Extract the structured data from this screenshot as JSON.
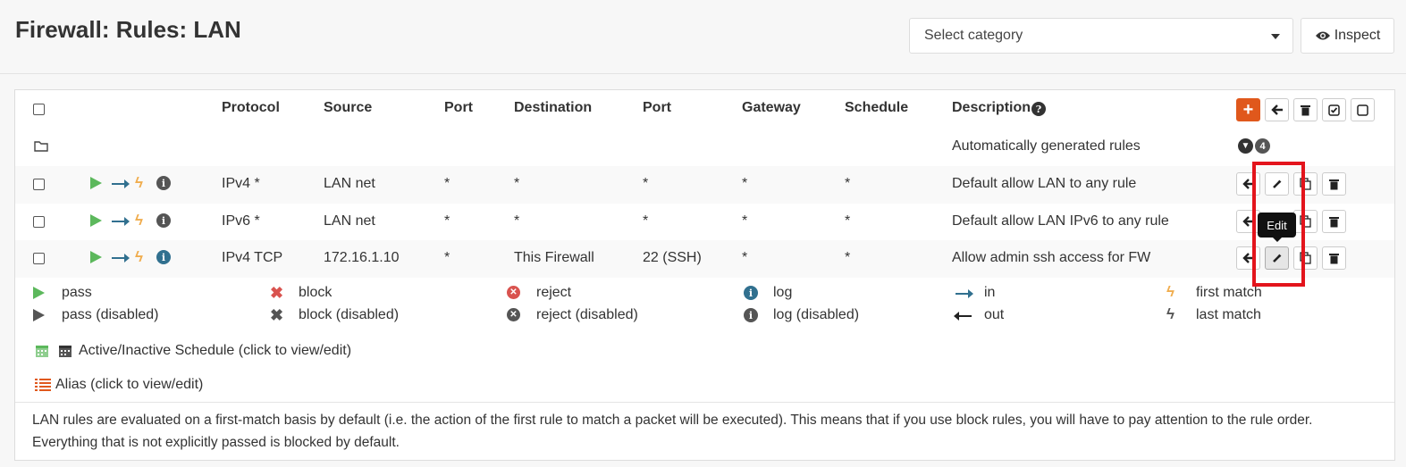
{
  "page": {
    "title": "Firewall: Rules: LAN"
  },
  "category_select": {
    "value": "Select category"
  },
  "inspect_button": {
    "label": "Inspect"
  },
  "table": {
    "headers": [
      "Protocol",
      "Source",
      "Port",
      "Destination",
      "Port",
      "Gateway",
      "Schedule",
      "Description"
    ],
    "auto_group": {
      "label": "Automatically generated rules",
      "count": "4"
    },
    "rules": [
      {
        "protocol": "IPv4 *",
        "source": "LAN net",
        "src_port": "*",
        "destination": "*",
        "dst_port": "*",
        "gateway": "*",
        "schedule": "*",
        "description": "Default allow LAN to any rule",
        "log_icon_color": "#555555"
      },
      {
        "protocol": "IPv6 *",
        "source": "LAN net",
        "src_port": "*",
        "destination": "*",
        "dst_port": "*",
        "gateway": "*",
        "schedule": "*",
        "description": "Default allow LAN IPv6 to any rule",
        "log_icon_color": "#555555"
      },
      {
        "protocol": "IPv4 TCP",
        "source": "172.16.1.10",
        "src_port": "*",
        "destination": "This Firewall",
        "dst_port": "22 (SSH)",
        "gateway": "*",
        "schedule": "*",
        "description": "Allow admin ssh access for FW",
        "log_icon_color": "#31708f"
      }
    ]
  },
  "legend": {
    "pass": "pass",
    "pass_disabled": "pass (disabled)",
    "block": "block",
    "block_disabled": "block (disabled)",
    "reject": "reject",
    "reject_disabled": "reject (disabled)",
    "log": "log",
    "log_disabled": "log (disabled)",
    "in": "in",
    "out": "out",
    "first_match": "first match",
    "last_match": "last match"
  },
  "schedule_note": "Active/Inactive Schedule (click to view/edit)",
  "alias_note": "Alias (click to view/edit)",
  "info_text": "LAN rules are evaluated on a first-match basis by default (i.e. the action of the first rule to match a packet will be executed). This means that if you use block rules, you will have to pay attention to the rule order. Everything that is not explicitly passed is blocked by default.",
  "tooltip": "Edit",
  "colors": {
    "accent": "#e0581c",
    "pass": "#5cb85c",
    "reject": "#d9534f",
    "direction": "#31708f",
    "highlight": "#e3141c"
  }
}
